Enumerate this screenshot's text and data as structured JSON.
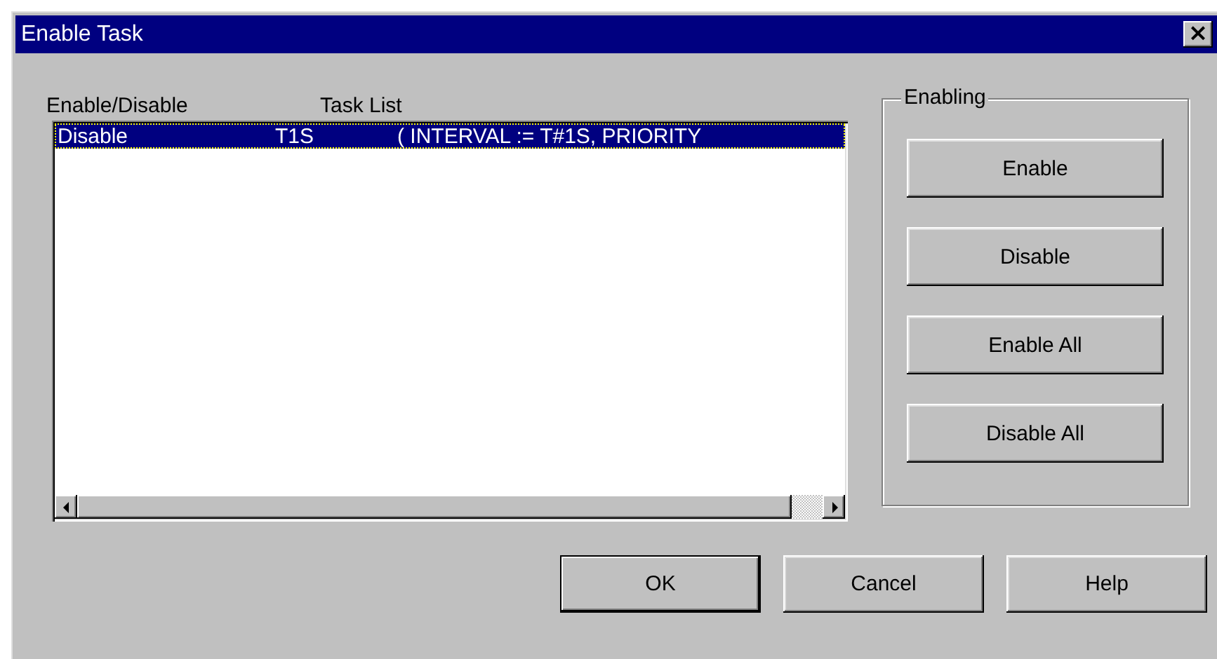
{
  "window": {
    "title": "Enable Task",
    "close": "×"
  },
  "list_headers": [
    "Enable/Disable",
    "Task List"
  ],
  "tasks": [
    {
      "state": "Disable",
      "name": "T1S",
      "properties": "( INTERVAL := T#1S,  PRIORITY",
      "selected": true
    }
  ],
  "enabling_group": {
    "title": "Enabling",
    "buttons": [
      "Enable",
      "Disable",
      "Enable All",
      "Disable All"
    ]
  },
  "buttons": [
    {
      "label": "OK",
      "default": true
    },
    {
      "label": "Cancel",
      "default": false
    },
    {
      "label": "Help",
      "default": false
    }
  ]
}
